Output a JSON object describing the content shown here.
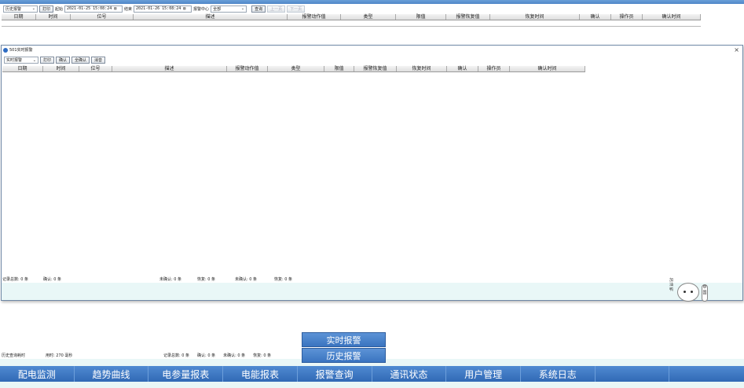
{
  "history": {
    "toolbar": {
      "mode": "历史报警",
      "print": "打印",
      "start_label": "起始",
      "start_value": "2021-01-25 15:08:24",
      "end_label": "结束",
      "end_value": "2021-01-26 15:08:24",
      "center_label": "报警中心",
      "center_value": "全部",
      "query": "查询",
      "prev": "上一页",
      "next": "下一页"
    },
    "columns": [
      "日期",
      "时间",
      "位号",
      "描述",
      "报警动作值",
      "类型",
      "限值",
      "报警恢复值",
      "恢复时间",
      "确认",
      "操作员",
      "确认时间"
    ],
    "status": {
      "left": "历史查询耗时",
      "time": "用时: 270 毫秒",
      "total": "记录总数: 0 条",
      "confirmed": "确认: 0 条",
      "unconfirmed": "未确认: 0 条",
      "recovered": "恢复: 0 条"
    }
  },
  "realtime": {
    "title": "501实时报警",
    "close": "×",
    "toolbar": {
      "mode": "实时报警",
      "print": "打印",
      "confirm": "确认",
      "confirm_all": "全确认",
      "clear": "消音"
    },
    "columns": [
      "日期",
      "时间",
      "位号",
      "描述",
      "报警动作值",
      "类型",
      "限值",
      "报警恢复值",
      "恢复时间",
      "确认",
      "操作员",
      "确认时间"
    ],
    "status": {
      "total": "记录总数: 0 条",
      "confirmed": "确认: 0 条",
      "unconfirmed1": "未确认: 0 条",
      "recovered1": "恢复: 0 条",
      "unconfirmed2": "未确认: 0 条",
      "recovered2": "恢复: 0 条"
    }
  },
  "mascot": {
    "left_text": "加油鸭",
    "side_text": "中国"
  },
  "submenu": [
    "实时报警",
    "历史报警"
  ],
  "nav": [
    "配电监测",
    "趋势曲线",
    "电参量报表",
    "电能报表",
    "报警查询",
    "通讯状态",
    "用户管理",
    "系统日志",
    "",
    ""
  ]
}
